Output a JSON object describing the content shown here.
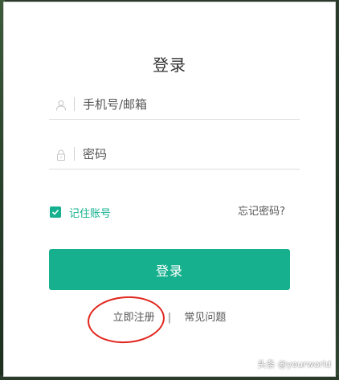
{
  "dialog": {
    "title": "登录",
    "account": {
      "placeholder": "手机号/邮箱",
      "icon": "user-icon"
    },
    "password": {
      "placeholder": "密码",
      "icon": "lock-icon"
    },
    "remember": {
      "label": "记住账号",
      "checked": true
    },
    "forgot_label": "忘记密码?",
    "login_button_label": "登录",
    "links": {
      "register": "立即注册",
      "separator": "|",
      "faq": "常见问题"
    }
  },
  "watermark": "头条 @yourworld",
  "colors": {
    "accent": "#17b08e",
    "annotation": "#e0261e"
  }
}
